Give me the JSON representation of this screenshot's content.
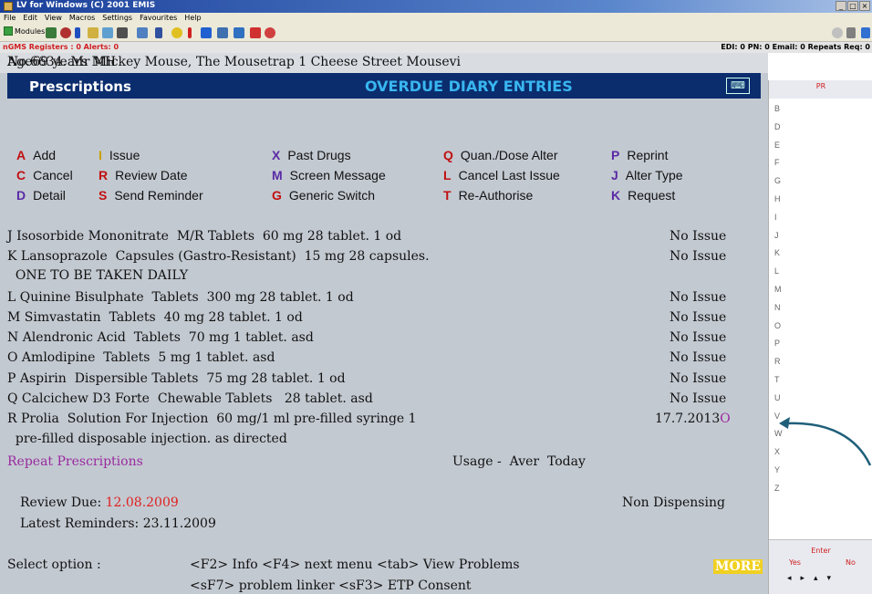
{
  "window": {
    "title": "LV for Windows (C) 2001 EMIS"
  },
  "menu": [
    "File",
    "Edit",
    "View",
    "Macros",
    "Settings",
    "Favourites",
    "Help"
  ],
  "toolbar": {
    "modules_label": "Modules"
  },
  "status": {
    "left": "nGMS Registers : 0  Alerts: 0",
    "right": "EDI: 0  PN: 0  Email: 0  Repeats Req: 0"
  },
  "patient": {
    "line": "No.6634. Mr Mickey Mouse, The Mousetrap 1 Cheese Street Mousevi",
    "age": "Age69 years MH"
  },
  "header": {
    "title": "Prescriptions",
    "alert": "OVERDUE DIARY ENTRIES"
  },
  "options": {
    "col1": [
      {
        "key": "A",
        "label": "Add"
      },
      {
        "key": "C",
        "label": "Cancel"
      },
      {
        "key": "D",
        "label": "Detail"
      }
    ],
    "col2": [
      {
        "key": "I",
        "label": "Issue"
      },
      {
        "key": "R",
        "label": "Review Date"
      },
      {
        "key": "S",
        "label": "Send Reminder"
      }
    ],
    "col3": [
      {
        "key": "X",
        "label": "Past Drugs"
      },
      {
        "key": "M",
        "label": "Screen Message"
      },
      {
        "key": "G",
        "label": "Generic Switch"
      }
    ],
    "col4": [
      {
        "key": "Q",
        "label": "Quan./Dose Alter"
      },
      {
        "key": "L",
        "label": "Cancel Last Issue"
      },
      {
        "key": "T",
        "label": "Re-Authorise"
      }
    ],
    "col5": [
      {
        "key": "P",
        "label": "Reprint"
      },
      {
        "key": "J",
        "label": "Alter Type"
      },
      {
        "key": "K",
        "label": "Request"
      }
    ]
  },
  "drugs": [
    {
      "text": "J Isosorbide Mononitrate  M/R Tablets  60 mg 28 tablet. 1 od",
      "status": "No Issue"
    },
    {
      "text": "K Lansoprazole  Capsules (Gastro-Resistant)  15 mg 28 capsules.",
      "status": "No Issue"
    },
    {
      "text": "  ONE TO BE TAKEN DAILY",
      "status": ""
    },
    {
      "text": "L Quinine Bisulphate  Tablets  300 mg 28 tablet. 1 od",
      "status": "No Issue"
    },
    {
      "text": "M Simvastatin  Tablets  40 mg 28 tablet. 1 od",
      "status": "No Issue"
    },
    {
      "text": "N Alendronic Acid  Tablets  70 mg 1 tablet. asd",
      "status": "No Issue"
    },
    {
      "text": "O Amlodipine  Tablets  5 mg 1 tablet. asd",
      "status": "No Issue"
    },
    {
      "text": "P Aspirin  Dispersible Tablets  75 mg 28 tablet. 1 od",
      "status": "No Issue"
    },
    {
      "text": "Q Calcichew D3 Forte  Chewable Tablets   28 tablet. asd",
      "status": "No Issue"
    },
    {
      "text": "R Prolia  Solution For Injection  60 mg/1 ml pre-filled syringe 1",
      "status": "17.7.2013",
      "status_suffix": "O"
    },
    {
      "text": "  pre-filled disposable injection. as directed",
      "status": ""
    }
  ],
  "repeat": {
    "label": "Repeat Prescriptions",
    "usage": "Usage -  Aver  Today"
  },
  "review": {
    "label": "Review Due: ",
    "date": "12.08.2009",
    "dispensing": "Non Dispensing"
  },
  "reminders": "Latest Reminders: 23.11.2009",
  "prompt": {
    "label": "Select option :",
    "line1": "<F2> Info <F4> next menu <tab> View Problems",
    "line2": "<sF7> problem linker <sF3> ETP Consent",
    "more": "MORE"
  },
  "sidebar": {
    "header": "PR",
    "letters": [
      "B",
      "D",
      "E",
      "F",
      "G",
      "H",
      "I",
      "J",
      "K",
      "L",
      "M",
      "N",
      "O",
      "P",
      "R",
      "T",
      "U",
      "V",
      "W",
      "X",
      "Y",
      "Z"
    ],
    "enter": "Enter",
    "yes": "Yes",
    "no": "No"
  },
  "colors": {
    "header_bg": "#0b2d6e",
    "alert_text": "#39b6f0",
    "terminal_bg": "#c3c9d1",
    "arrow": "#1f5f7a"
  }
}
